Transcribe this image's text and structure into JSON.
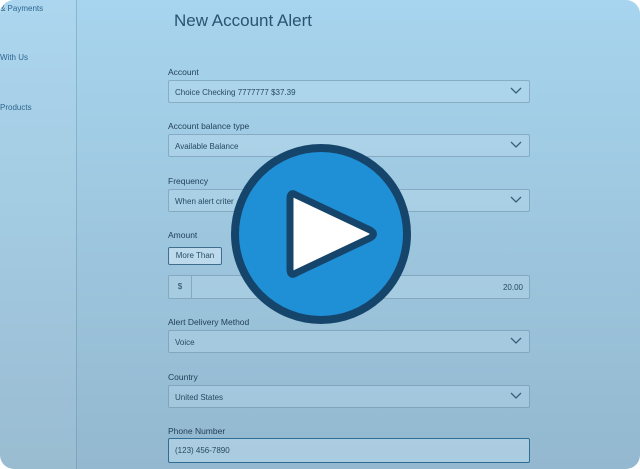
{
  "sidebar": {
    "items": [
      {
        "label": "& Payments"
      },
      {
        "label": "With Us"
      },
      {
        "label": "Products"
      }
    ]
  },
  "page": {
    "title": "New Account Alert"
  },
  "form": {
    "account": {
      "label": "Account",
      "value": "Choice Checking 7777777 $37.39"
    },
    "balance_type": {
      "label": "Account balance type",
      "value": "Available Balance"
    },
    "frequency": {
      "label": "Frequency",
      "value": "When alert criter"
    },
    "amount": {
      "label": "Amount",
      "comparator": "More Than",
      "currency": "$",
      "value": "20.00"
    },
    "delivery_method": {
      "label": "Alert Delivery Method",
      "value": "Voice"
    },
    "country": {
      "label": "Country",
      "value": "United States"
    },
    "phone": {
      "label": "Phone Number",
      "value": "(123) 456-7890"
    }
  },
  "overlay": {
    "icon": "play-icon",
    "colors": {
      "circle": "#1f8fd6",
      "ring": "#16456b",
      "triangle": "#ffffff"
    }
  }
}
